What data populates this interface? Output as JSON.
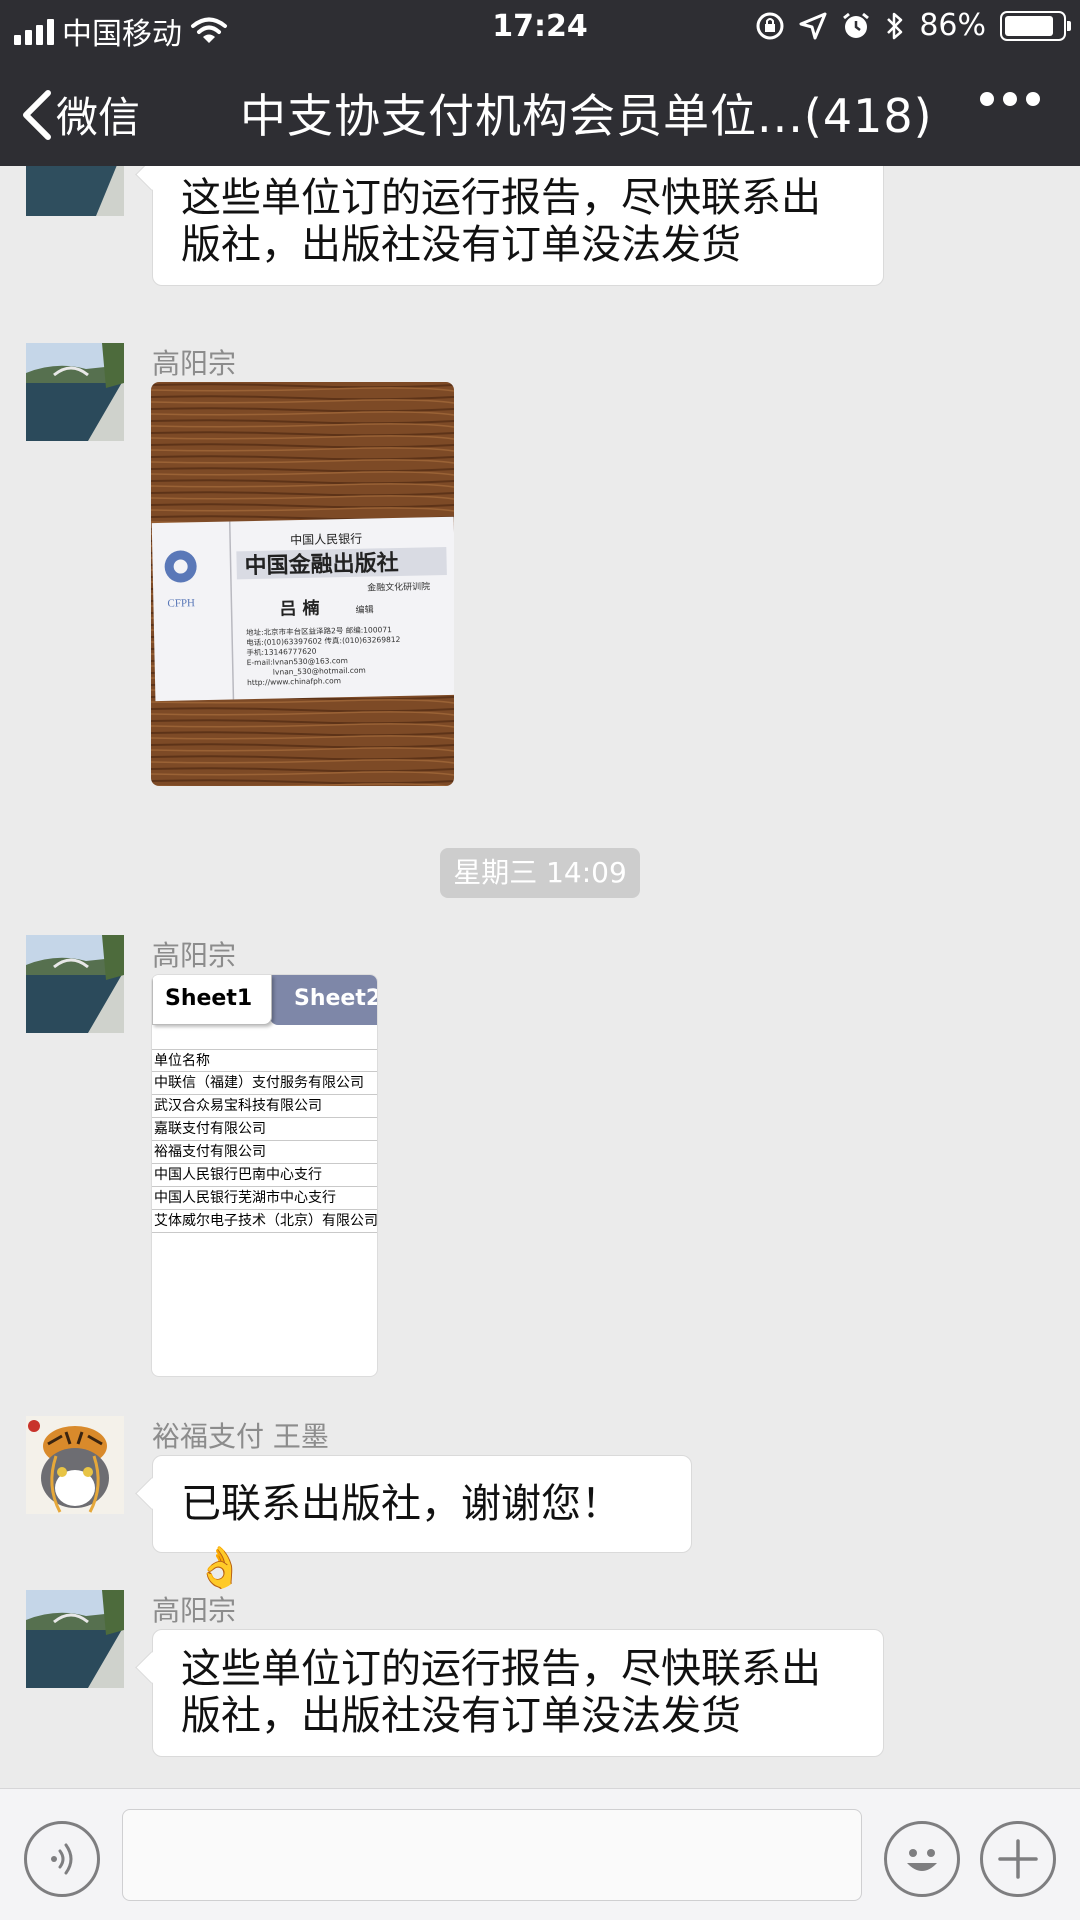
{
  "status_bar": {
    "carrier": "中国移动",
    "time": "17:24",
    "battery_percent": "86%",
    "battery_level": 0.86
  },
  "nav": {
    "back_label": "微信",
    "title": "中支协支付机构会员单位...(418)"
  },
  "messages": {
    "top_partial": {
      "text": "这些单位订的运行报告，尽快联系出版社，出版社没有订单没法发货"
    },
    "image_msg": {
      "sender": "高阳宗",
      "card": {
        "bank": "中国人民银行",
        "publisher": "中国金融出版社",
        "logo_text": "CFPH",
        "name": "吕 楠",
        "role": "编辑",
        "dept": "金融文化研训院",
        "lines": [
          "地址:北京市丰台区益泽路2号  邮编:100071",
          "电话:(010)63397602    传真:(010)63269812",
          "手机:13146777620",
          "E-mail:lvnan530@163.com",
          "lvnan_530@hotmail.com",
          "http://www.chinafph.com"
        ]
      }
    },
    "time_separator": "星期三 14:09",
    "file_msg": {
      "sender": "高阳宗",
      "tabs": [
        "Sheet1",
        "Sheet2"
      ],
      "rows": [
        "单位名称",
        "中联信（福建）支付服务有限公司",
        "武汉合众易宝科技有限公司",
        "嘉联支付有限公司",
        "裕福支付有限公司",
        "中国人民银行巴南中心支行",
        "中国人民银行芜湖市中心支行",
        "艾体威尔电子技术（北京）有限公司"
      ]
    },
    "reply_msg": {
      "sender": "裕福支付 王墨",
      "text": "已联系出版社，谢谢您！",
      "emoji": "👌"
    },
    "last_msg": {
      "sender": "高阳宗",
      "text": "这些单位订的运行报告，尽快联系出版社，出版社没有订单没法发货"
    }
  },
  "input_bar": {
    "voice_icon": "voice-icon",
    "emoji_icon": "emoji-icon",
    "plus_icon": "plus-icon"
  }
}
